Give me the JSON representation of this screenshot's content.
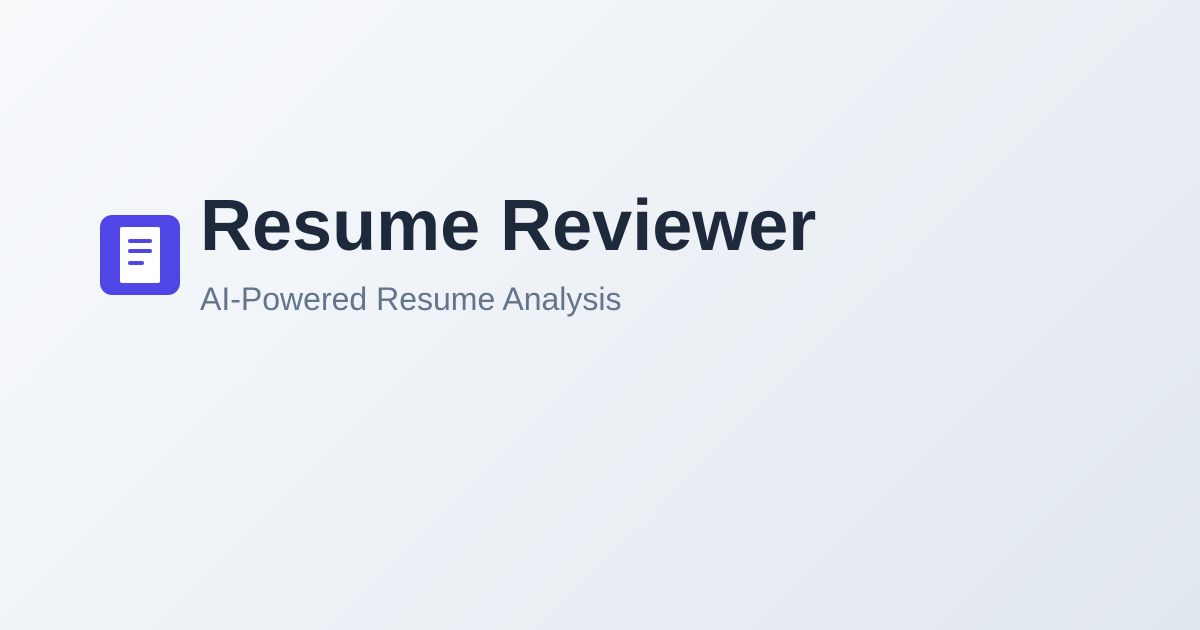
{
  "brand": {
    "title": "Resume Reviewer",
    "subtitle": "AI-Powered Resume Analysis",
    "logo_icon": "document-icon"
  },
  "colors": {
    "background_start": "#f8fafc",
    "background_end": "#e2e8f0",
    "accent": "#4f46e5",
    "title": "#1e293b",
    "subtitle": "#64748b",
    "icon_paper": "#ffffff"
  }
}
